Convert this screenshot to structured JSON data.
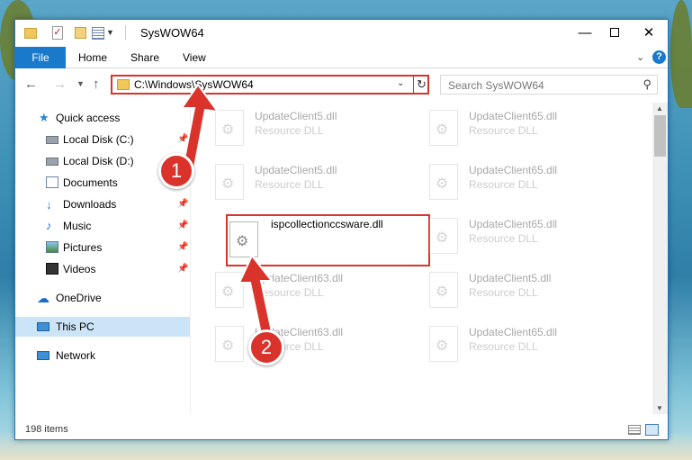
{
  "window": {
    "title": "SysWOW64",
    "minimize_glyph": "—",
    "close_glyph": "✕"
  },
  "ribbon": {
    "tabs": [
      "File",
      "Home",
      "Share",
      "View"
    ],
    "help_label": "?"
  },
  "address_bar": {
    "path": "C:\\Windows\\SysWOW64"
  },
  "search": {
    "placeholder": "Search SysWOW64"
  },
  "sidebar": {
    "items": [
      {
        "label": "Quick access",
        "icon": "star-icon"
      },
      {
        "label": "Local Disk (C:)",
        "icon": "drive-icon",
        "pinned": true
      },
      {
        "label": "Local Disk (D:)",
        "icon": "drive-icon",
        "pinned": false
      },
      {
        "label": "Documents",
        "icon": "documents-icon",
        "pinned": true
      },
      {
        "label": "Downloads",
        "icon": "downloads-icon",
        "pinned": true
      },
      {
        "label": "Music",
        "icon": "music-icon",
        "pinned": true
      },
      {
        "label": "Pictures",
        "icon": "pictures-icon",
        "pinned": true
      },
      {
        "label": "Videos",
        "icon": "videos-icon",
        "pinned": true
      },
      {
        "label": "OneDrive",
        "icon": "onedrive-icon"
      },
      {
        "label": "This PC",
        "icon": "pc-icon",
        "selected": true
      },
      {
        "label": "Network",
        "icon": "network-icon"
      }
    ]
  },
  "files": [
    {
      "name": "UpdateClient5.dll",
      "type": "Resource DLL",
      "dim": true
    },
    {
      "name": "UpdateClient65.dll",
      "type": "Resource DLL",
      "dim": true
    },
    {
      "name": "UpdateClient5.dll",
      "type": "Resource DLL",
      "dim": true
    },
    {
      "name": "UpdateClient65.dll",
      "type": "Resource DLL",
      "dim": true
    },
    {
      "name": "ispcollectionccsware.dll",
      "type": "",
      "dim": false,
      "highlighted": true
    },
    {
      "name": "UpdateClient65.dll",
      "type": "Resource DLL",
      "dim": true
    },
    {
      "name": "UpdateClient63.dll",
      "type": "Resource DLL",
      "dim": true
    },
    {
      "name": "UpdateClient5.dll",
      "type": "Resource DLL",
      "dim": true
    },
    {
      "name": "UpdateClient63.dll",
      "type": "Resource DLL",
      "dim": true
    },
    {
      "name": "UpdateClient65.dll",
      "type": "Resource DLL",
      "dim": true
    }
  ],
  "status_bar": {
    "item_count": "198 items"
  },
  "annotations": {
    "badge_1": "1",
    "badge_2": "2"
  },
  "colors": {
    "accent": "#1979ca",
    "annotation_red": "#d9332b",
    "selection": "#cce4f7"
  }
}
